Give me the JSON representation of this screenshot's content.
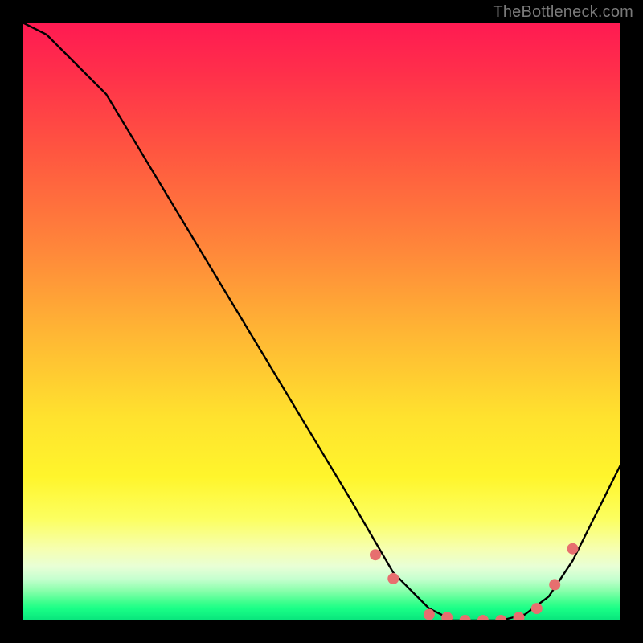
{
  "watermark": "TheBottleneck.com",
  "chart_data": {
    "type": "line",
    "title": "",
    "xlabel": "",
    "ylabel": "",
    "xlim": [
      0,
      100
    ],
    "ylim": [
      0,
      100
    ],
    "series": [
      {
        "name": "bottleneck-curve",
        "x": [
          0,
          4,
          8,
          14,
          55,
          62,
          68,
          72,
          76,
          80,
          84,
          88,
          92,
          100
        ],
        "values": [
          100,
          98,
          94,
          88,
          20,
          8,
          2,
          0,
          0,
          0,
          1,
          4,
          10,
          26
        ]
      }
    ],
    "markers": {
      "name": "highlight-dots",
      "x": [
        59,
        62,
        68,
        71,
        74,
        77,
        80,
        83,
        86,
        89,
        92
      ],
      "values": [
        11,
        7,
        1,
        0.5,
        0,
        0,
        0,
        0.5,
        2,
        6,
        12
      ]
    },
    "gradient_stops": [
      {
        "pos": 0,
        "color": "#ff1a52"
      },
      {
        "pos": 22,
        "color": "#ff5740"
      },
      {
        "pos": 52,
        "color": "#ffb634"
      },
      {
        "pos": 76,
        "color": "#fff52c"
      },
      {
        "pos": 93,
        "color": "#c6ffcf"
      },
      {
        "pos": 100,
        "color": "#08e47c"
      }
    ]
  }
}
